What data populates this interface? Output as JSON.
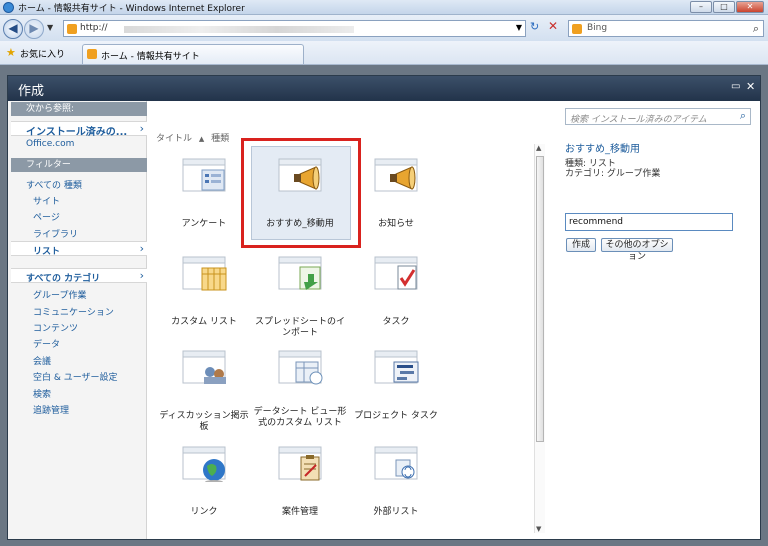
{
  "window": {
    "title": "ホーム - 情報共有サイト - Windows Internet Explorer"
  },
  "address": {
    "url": "http://",
    "search_engine": "Bing"
  },
  "favorites": {
    "label": "お気に入り",
    "tab_title": "ホーム - 情報共有サイト"
  },
  "dialog": {
    "title": "作成"
  },
  "sort": {
    "title_label": "タイトル",
    "type_label": "種類"
  },
  "leftnav": {
    "browse_header": "次から参照:",
    "installed": "インストール済みの...",
    "office": "Office.com",
    "filter_header": "フィルター",
    "all_types": "すべての 種類",
    "types": [
      "サイト",
      "ページ",
      "ライブラリ",
      "リスト"
    ],
    "all_categories": "すべての カテゴリ",
    "categories": [
      "グループ作業",
      "コミュニケーション",
      "コンテンツ",
      "データ",
      "会議",
      "空白 & ユーザー設定",
      "検索",
      "追跡管理"
    ]
  },
  "tiles": [
    "アンケート",
    "おすすめ_移動用",
    "お知らせ",
    "カスタム リスト",
    "スプレッドシートのインポート",
    "タスク",
    "ディスカッション掲示板",
    "データシート ビュー形式のカスタム リスト",
    "プロジェクト タスク",
    "リンク",
    "案件管理",
    "外部リスト"
  ],
  "right": {
    "search_placeholder": "検索 インストール済みのアイテム",
    "selected_name": "おすすめ_移動用",
    "meta_type": "種類: リスト",
    "meta_category": "カテゴリ: グループ作業",
    "name_value": "recommend",
    "create_button": "作成",
    "options_button": "その他のオプション"
  },
  "colors": {
    "accent_red": "#d9221e",
    "link_blue": "#1d5c9c",
    "header_dark": "#22334a"
  }
}
